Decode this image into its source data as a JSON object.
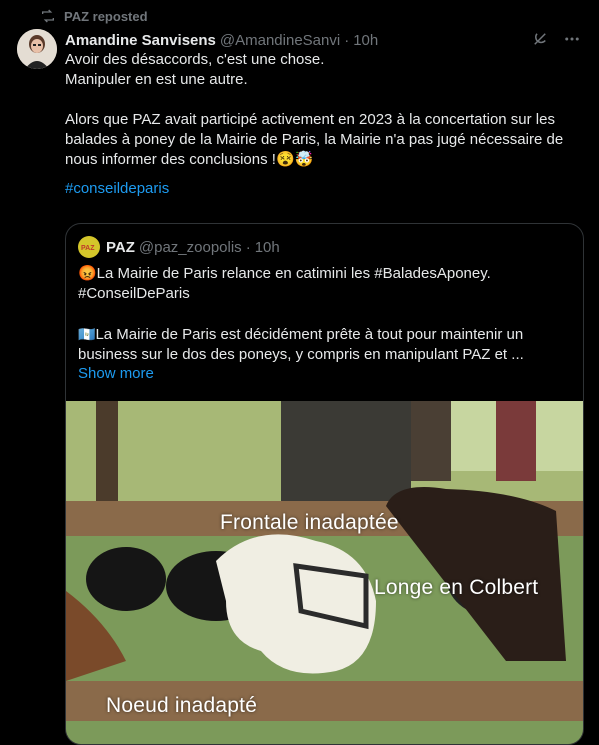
{
  "repost": {
    "label": "PAZ reposted",
    "icon": "repost-icon"
  },
  "tweet": {
    "author_name": "Amandine Sanvisens",
    "author_handle": "@AmandineSanvi",
    "separator": "·",
    "time": "10h",
    "text": "Avoir des désaccords, c'est une chose.\nManipuler en est une autre.\n\nAlors que PAZ avait participé activement en 2023 à la concertation sur les balades à poney de la Mairie de Paris, la Mairie n'a pas jugé nécessaire de nous informer des conclusions !😵🤯",
    "hashtag": "#conseildeparis"
  },
  "quote": {
    "avatar_text": "PAZ",
    "author_name": "PAZ",
    "author_handle": "@paz_zoopolis",
    "separator": "·",
    "time": "10h",
    "line1": "😡La Mairie de Paris relance en catimini les #BaladesAponey.",
    "line2": "#ConseilDeParis",
    "line3": "La Mairie de Paris est décidément prête à tout pour maintenir un business sur le dos des poneys, y compris en manipulant PAZ et ...",
    "show_more": "Show more",
    "image_labels": {
      "label1": "Frontale inadaptée",
      "label2": "Longe en Colbert",
      "label3": "Noeud inadapté"
    }
  }
}
